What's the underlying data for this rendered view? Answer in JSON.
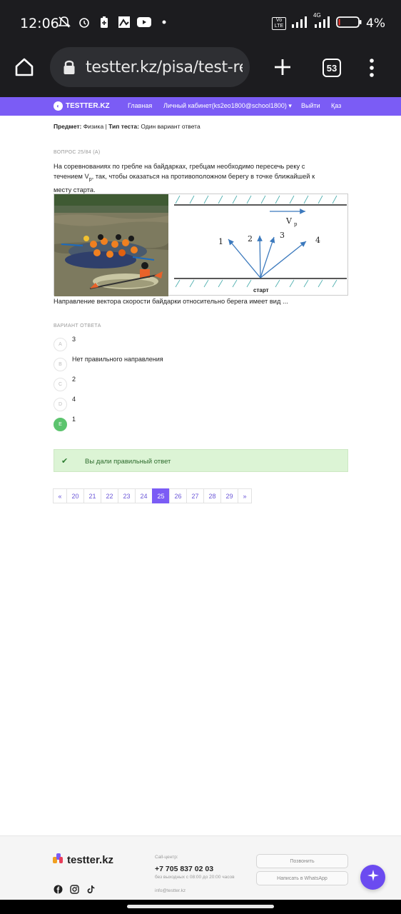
{
  "status_bar": {
    "time": "12:06",
    "network": "4G",
    "volte": "Vo LTE",
    "battery": "4%",
    "icons": [
      "muted-bell-icon",
      "alarm-icon",
      "battery-saver-icon",
      "image-icon",
      "youtube-icon",
      "dot-icon"
    ]
  },
  "browser": {
    "url": "testter.kz/pisa/test-re",
    "tab_count": "53"
  },
  "nav": {
    "brand": "TESTTER.KZ",
    "items": [
      "Главная",
      "Личный кабинет(ks2eo1800@school1800) ▾",
      "Выйти",
      "Қаз"
    ]
  },
  "meta": {
    "subject_label": "Предмет:",
    "subject_value": "Физика",
    "separator": "|",
    "type_label": "Тип теста:",
    "type_value": "Один вариант ответа"
  },
  "question": {
    "number_label": "ВОПРОС 25/84 (A)",
    "text_line1": "На соревнованиях по гребле на байдарках, гребцам необходимо пересечь реку с",
    "text_line2_pre": "течением V",
    "text_line2_sub": "р",
    "text_line2_post": ", так, чтобы оказаться на противоположном берегу в точке ближайшей к",
    "text_line3": "месту старта.",
    "caption": "Направление вектора скорости байдарки относительно берега имеет вид ...",
    "diagram": {
      "vector_label": "V",
      "vector_sub": "р",
      "labels": [
        "1",
        "2",
        "3",
        "4"
      ],
      "start_label": "старт"
    }
  },
  "answers": {
    "title": "ВАРИАНТ ОТВЕТА",
    "options": [
      {
        "letter": "A",
        "text": "3"
      },
      {
        "letter": "B",
        "text": "Нет правильного направления"
      },
      {
        "letter": "C",
        "text": "2"
      },
      {
        "letter": "D",
        "text": "4"
      },
      {
        "letter": "E",
        "text": "1"
      }
    ],
    "selected": "E"
  },
  "result": {
    "message": "Вы дали правильный ответ",
    "color": "#dcf4d5"
  },
  "pagination": {
    "prev": "«",
    "pages": [
      "20",
      "21",
      "22",
      "23",
      "24",
      "25",
      "26",
      "27",
      "28",
      "29"
    ],
    "current": "25",
    "next": "»"
  },
  "footer": {
    "brand": "testter.kz",
    "call_label": "Call-центр:",
    "phone": "+7 705 837 02 03",
    "hours": "без выходных с 08:00 до 20:00 часов",
    "email": "info@testter.kz",
    "call_button": "Позвонить",
    "whatsapp_button": "Написать в WhatsApp",
    "social": [
      "facebook-icon",
      "instagram-icon",
      "tiktok-icon"
    ]
  },
  "colors": {
    "accent": "#7b5cf5",
    "correct": "#5cc46e"
  }
}
